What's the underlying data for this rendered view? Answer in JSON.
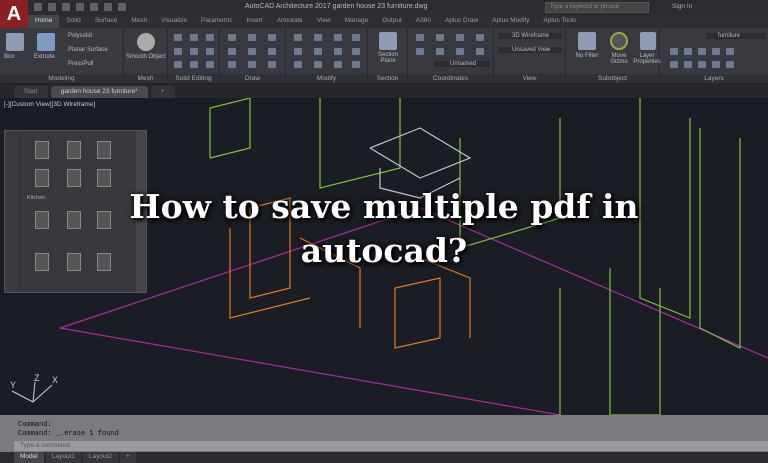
{
  "app": {
    "logo": "A",
    "title": "AutoCAD Architecture 2017   garden house 23 furniture.dwg",
    "search_placeholder": "Type a keyword or phrase",
    "sign_in": "Sign In"
  },
  "ribbon_tabs": [
    "Home",
    "Solid",
    "Surface",
    "Mesh",
    "Visualize",
    "Parametric",
    "Insert",
    "Annotate",
    "View",
    "Manage",
    "Output",
    "A360",
    "Aplus Draw",
    "Aplus Modify",
    "Aplus Tools"
  ],
  "panels": {
    "modeling": {
      "label": "Modeling",
      "box": "Box",
      "extrude": "Extrude",
      "polysolid": "Polysolid",
      "planar_surface": "Planar Surface",
      "presspull": "PressPull"
    },
    "mesh": {
      "label": "Mesh",
      "smooth_object": "Smooth Object"
    },
    "solid_editing": {
      "label": "Solid Editing"
    },
    "draw": {
      "label": "Draw"
    },
    "modify": {
      "label": "Modify"
    },
    "section": {
      "label": "Section",
      "section_plane": "Section Plane"
    },
    "coordinates": {
      "label": "Coordinates",
      "ucs": "Unnamed"
    },
    "view": {
      "label": "View",
      "visual_style": "3D Wireframe",
      "saved_view": "Unsaved View"
    },
    "subobject": {
      "label": "Subobject",
      "no_filter": "No Filter",
      "move_gizmo": "Move Gizmo"
    },
    "layers": {
      "label": "Layers",
      "layer_properties": "Layer Properties",
      "current_layer": "furniture"
    }
  },
  "doc_tabs": [
    "Start",
    "garden house 23 furniture*",
    "+"
  ],
  "viewport_label": "[-][Custom View][3D Wireframe]",
  "palette": {
    "section_label": "Kitchen",
    "colors": {
      "bg": "#3c3e44"
    }
  },
  "command": {
    "history": [
      "Command:",
      "Command: _.erase 1 found"
    ],
    "placeholder": "Type a command"
  },
  "layout_tabs": [
    "Model",
    "Layout1",
    "Layout2",
    "+"
  ],
  "headline": [
    "How to save multiple pdf in",
    "autocad?"
  ],
  "colors": {
    "accent": "#8a1f24",
    "wire_green": "#7fbf3a",
    "wire_orange": "#e07a20",
    "wire_magenta": "#b02a9a",
    "viewport_bg": "#1b1d25"
  }
}
